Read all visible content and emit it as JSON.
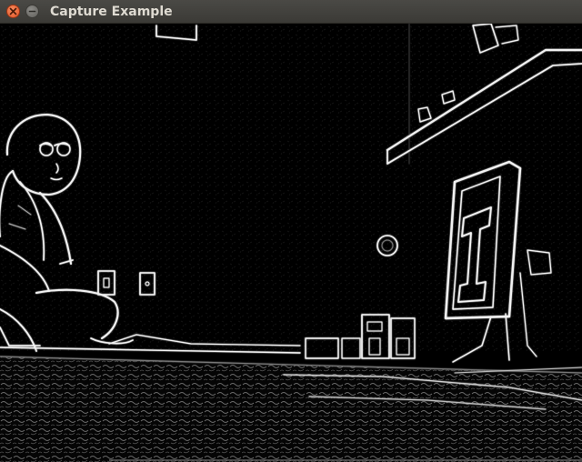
{
  "window": {
    "title": "Capture Example",
    "close_button": "close",
    "minimize_button": "minimize"
  },
  "frame": {
    "description_icon": "edge-detected-video-frame",
    "accent_colors": {
      "titlebar": "#3c3b37",
      "close": "#e95420",
      "edge": "#ffffff",
      "background": "#000000"
    }
  }
}
